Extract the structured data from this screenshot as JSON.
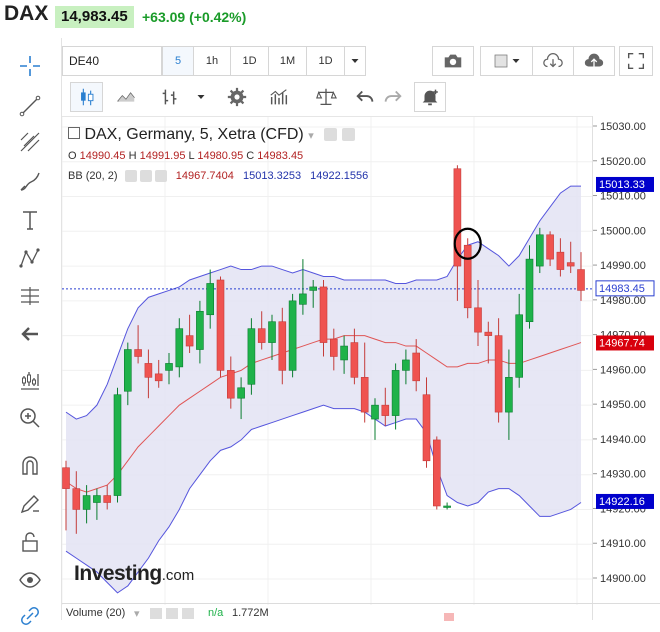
{
  "header": {
    "symbol": "DAX",
    "price": "14,983.45",
    "change": "+63.09 (+0.42%)"
  },
  "toolbar": {
    "symbol_input": "DE40",
    "intervals": [
      "5",
      "1h",
      "1D",
      "1M",
      "1D"
    ]
  },
  "legend": {
    "title": "DAX, Germany, 5, Xetra (CFD)",
    "ohlc_labels": [
      "O",
      "H",
      "L",
      "C"
    ],
    "ohlc_values": [
      "14990.45",
      "14991.95",
      "14980.95",
      "14983.45"
    ],
    "bb_label": "BB (20, 2)",
    "bb_values": [
      "14967.7404",
      "15013.3253",
      "14922.1556"
    ]
  },
  "volume": {
    "label": "Volume (20)",
    "na": "n/a",
    "value": "1.772M"
  },
  "watermark": {
    "main": "Investing",
    "suffix": ".com"
  },
  "colors": {
    "up": "#1fb24a",
    "down": "#ef5350",
    "band_fill": "#e3e3f3",
    "band_line": "#5555dd",
    "basis_line": "#e05555",
    "current_price": "#2a3fd0",
    "lower_label": "#0000cc"
  },
  "chart_data": {
    "type": "candlestick",
    "y_ticks": [
      14900,
      14910,
      14920,
      14930,
      14940,
      14950,
      14960,
      14970,
      14980,
      14990,
      15000,
      15010,
      15020,
      15030
    ],
    "y_tick_labels": [
      "14900.00",
      "14910.00",
      "14920.00",
      "14930.00",
      "14940.00",
      "14950.00",
      "14960.00",
      "14970.00",
      "14980.00",
      "14990.00",
      "15000.00",
      "15010.00",
      "15020.00",
      "15030.00"
    ],
    "ylim": [
      14895,
      15034
    ],
    "price_labels": [
      {
        "value": 15013.33,
        "text": "15013.33",
        "kind": "upper"
      },
      {
        "value": 14983.45,
        "text": "14983.45",
        "kind": "current"
      },
      {
        "value": 14967.74,
        "text": "14967.74",
        "kind": "basis"
      },
      {
        "value": 14922.16,
        "text": "14922.16",
        "kind": "lower"
      }
    ],
    "current_price": 14983.45,
    "candles": [
      [
        14932,
        14934,
        14914,
        14926
      ],
      [
        14926,
        14931,
        14913,
        14920
      ],
      [
        14920,
        14927,
        14916,
        14924
      ],
      [
        14922,
        14926,
        14917,
        14924
      ],
      [
        14924,
        14927,
        14920,
        14922
      ],
      [
        14924,
        14955,
        14922,
        14953
      ],
      [
        14954,
        14968,
        14950,
        14966
      ],
      [
        14966,
        14973,
        14962,
        14964
      ],
      [
        14962,
        14966,
        14952,
        14958
      ],
      [
        14959,
        14963,
        14955,
        14957
      ],
      [
        14960,
        14965,
        14956,
        14962
      ],
      [
        14961,
        14975,
        14958,
        14972
      ],
      [
        14970,
        14976,
        14965,
        14967
      ],
      [
        14966,
        14980,
        14962,
        14977
      ],
      [
        14976,
        14989,
        14972,
        14985
      ],
      [
        14986,
        14987,
        14958,
        14960
      ],
      [
        14960,
        14964,
        14949,
        14952
      ],
      [
        14952,
        14958,
        14946,
        14955
      ],
      [
        14956,
        14975,
        14953,
        14972
      ],
      [
        14972,
        14977,
        14966,
        14968
      ],
      [
        14968,
        14976,
        14963,
        14974
      ],
      [
        14974,
        14978,
        14956,
        14960
      ],
      [
        14960,
        14982,
        14958,
        14980
      ],
      [
        14979,
        14992,
        14976,
        14982
      ],
      [
        14983,
        14986,
        14978,
        14984
      ],
      [
        14984,
        14986,
        14964,
        14968
      ],
      [
        14969,
        14972,
        14960,
        14964
      ],
      [
        14963,
        14970,
        14959,
        14967
      ],
      [
        14968,
        14972,
        14956,
        14958
      ],
      [
        14958,
        14968,
        14945,
        14948
      ],
      [
        14946,
        14952,
        14940,
        14950
      ],
      [
        14950,
        14955,
        14944,
        14947
      ],
      [
        14947,
        14962,
        14943,
        14960
      ],
      [
        14960,
        14966,
        14956,
        14963
      ],
      [
        14965,
        14969,
        14954,
        14957
      ],
      [
        14953,
        14958,
        14932,
        14934
      ],
      [
        14940,
        14941,
        14920,
        14921
      ],
      [
        14921,
        14922,
        14920,
        14921
      ],
      [
        15018,
        15019,
        14980,
        14990
      ],
      [
        14996,
        14998,
        14975,
        14978
      ],
      [
        14978,
        14986,
        14967,
        14971
      ],
      [
        14971,
        14974,
        14962,
        14970
      ],
      [
        14970,
        14975,
        14945,
        14948
      ],
      [
        14948,
        14966,
        14940,
        14958
      ],
      [
        14958,
        14982,
        14955,
        14976
      ],
      [
        14974,
        14996,
        14972,
        14992
      ],
      [
        14990,
        15001,
        14988,
        14999
      ],
      [
        14999,
        15000,
        14990,
        14992
      ],
      [
        14994,
        14998,
        14987,
        14989
      ],
      [
        14991,
        14997,
        14988,
        14990
      ],
      [
        14989,
        14994,
        14980,
        14983
      ]
    ],
    "bb_upper": [
      14948,
      14946,
      14947,
      14950,
      14956,
      14964,
      14972,
      14978,
      14981,
      14982,
      14983,
      14984,
      14986,
      14987,
      14988,
      14989,
      14990,
      14989,
      14989,
      14990,
      14990,
      14989,
      14988,
      14989,
      14988,
      14987,
      14987,
      14986,
      14986,
      14986,
      14986,
      14986,
      14985,
      14985,
      14986,
      14986,
      14986,
      14987,
      14992,
      14996,
      14997,
      14995,
      14993,
      14990,
      14993,
      14998,
      15003,
      15007,
      15011,
      15013,
      15013
    ],
    "bb_basis": [
      14928,
      14926,
      14925,
      14926,
      14927,
      14930,
      14934,
      14938,
      14941,
      14944,
      14947,
      14950,
      14952,
      14954,
      14956,
      14958,
      14959,
      14960,
      14962,
      14963,
      14964,
      14965,
      14966,
      14967,
      14968,
      14969,
      14969,
      14970,
      14970,
      14970,
      14969,
      14968,
      14968,
      14967,
      14967,
      14965,
      14963,
      14961,
      14961,
      14962,
      14962,
      14963,
      14963,
      14962,
      14962,
      14963,
      14964,
      14965,
      14966,
      14967,
      14968
    ],
    "bb_lower": [
      14908,
      14906,
      14904,
      14902,
      14899,
      14896,
      14898,
      14902,
      14906,
      14911,
      14915,
      14920,
      14926,
      14930,
      14934,
      14937,
      14938,
      14940,
      14943,
      14944,
      14945,
      14946,
      14947,
      14948,
      14949,
      14950,
      14949,
      14949,
      14949,
      14948,
      14946,
      14944,
      14945,
      14946,
      14946,
      14942,
      14932,
      14924,
      14922,
      14921,
      14922,
      14925,
      14926,
      14926,
      14924,
      14921,
      14918,
      14918,
      14919,
      14920,
      14922
    ]
  }
}
